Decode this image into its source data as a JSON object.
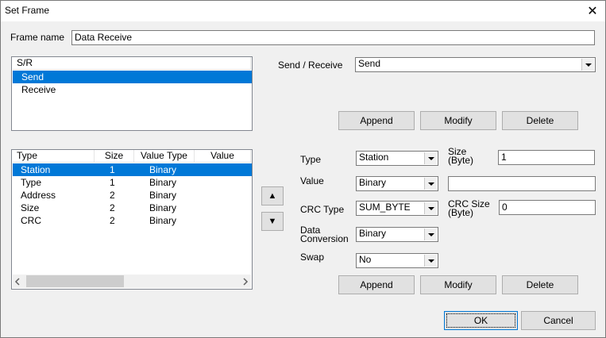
{
  "window": {
    "title": "Set Frame",
    "close_glyph": "✕"
  },
  "frame_name": {
    "label": "Frame name",
    "value": "Data Receive"
  },
  "sr_list": {
    "header": "S/R",
    "items": [
      "Send",
      "Receive"
    ],
    "selected_index": 0
  },
  "send_receive": {
    "label": "Send / Receive",
    "value": "Send"
  },
  "top_buttons": {
    "append": "Append",
    "modify": "Modify",
    "delete": "Delete"
  },
  "fields_table": {
    "columns": [
      "Type",
      "Size",
      "Value Type",
      "Value"
    ],
    "rows": [
      [
        "Station",
        "1",
        "Binary",
        ""
      ],
      [
        "Type",
        "1",
        "Binary",
        ""
      ],
      [
        "Address",
        "2",
        "Binary",
        ""
      ],
      [
        "Size",
        "2",
        "Binary",
        ""
      ],
      [
        "CRC",
        "2",
        "Binary",
        ""
      ]
    ],
    "selected_index": 0
  },
  "move_buttons": {
    "up": "▲",
    "down": "▼"
  },
  "field_editor": {
    "type_label": "Type",
    "type_value": "Station",
    "size_label_1": "Size",
    "size_label_2": "(Byte)",
    "size_value": "1",
    "value_label": "Value",
    "value_type": "Binary",
    "value_text": "",
    "crc_type_label": "CRC Type",
    "crc_type_value": "SUM_BYTE",
    "crc_size_label_1": "CRC Size",
    "crc_size_label_2": "(Byte)",
    "crc_size_value": "0",
    "data_conv_label_1": "Data",
    "data_conv_label_2": "Conversion",
    "data_conv_value": "Binary",
    "swap_label": "Swap",
    "swap_value": "No"
  },
  "bottom_buttons": {
    "append": "Append",
    "modify": "Modify",
    "delete": "Delete"
  },
  "dialog_buttons": {
    "ok": "OK",
    "cancel": "Cancel"
  }
}
